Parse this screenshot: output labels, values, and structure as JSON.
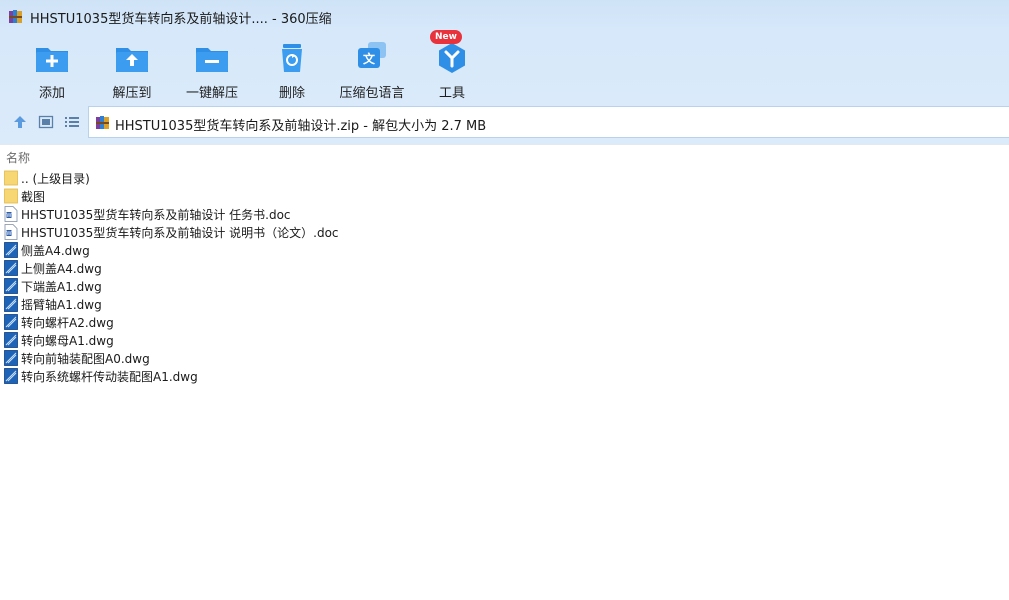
{
  "window": {
    "title": "HHSTU1035型货车转向系及前轴设计.... - 360压缩",
    "app_icon": "winrar-books-icon"
  },
  "toolbar": {
    "items": [
      {
        "label": "添加",
        "icon": "add-folder-icon"
      },
      {
        "label": "解压到",
        "icon": "extract-folder-icon"
      },
      {
        "label": "一键解压",
        "icon": "one-click-extract-icon"
      },
      {
        "label": "删除",
        "icon": "recycle-bin-icon"
      },
      {
        "label": "压缩包语言",
        "icon": "language-icon"
      },
      {
        "label": "工具",
        "icon": "tools-icon",
        "badge": "New"
      }
    ]
  },
  "nav": {
    "up_icon": "arrow-up-icon",
    "thumbnail_icon": "thumbnail-view-icon",
    "list_icon": "list-view-icon",
    "path": "HHSTU1035型货车转向系及前轴设计.zip - 解包大小为 2.7 MB"
  },
  "list": {
    "column_name": "名称",
    "files": [
      {
        "name": ".. (上级目录)",
        "type": "folder"
      },
      {
        "name": "截图",
        "type": "folder"
      },
      {
        "name": "HHSTU1035型货车转向系及前轴设计 任务书.doc",
        "type": "doc"
      },
      {
        "name": "HHSTU1035型货车转向系及前轴设计 说明书（论文）.doc",
        "type": "doc"
      },
      {
        "name": "侧盖A4.dwg",
        "type": "dwg"
      },
      {
        "name": "上侧盖A4.dwg",
        "type": "dwg"
      },
      {
        "name": "下端盖A1.dwg",
        "type": "dwg"
      },
      {
        "name": "摇臂轴A1.dwg",
        "type": "dwg"
      },
      {
        "name": "转向螺杆A2.dwg",
        "type": "dwg"
      },
      {
        "name": "转向螺母A1.dwg",
        "type": "dwg"
      },
      {
        "name": "转向前轴装配图A0.dwg",
        "type": "dwg"
      },
      {
        "name": "转向系统螺杆传动装配图A1.dwg",
        "type": "dwg"
      }
    ]
  },
  "colors": {
    "accent": "#2f8fe6",
    "folder": "#f7d774",
    "badge": "#e8323c"
  }
}
